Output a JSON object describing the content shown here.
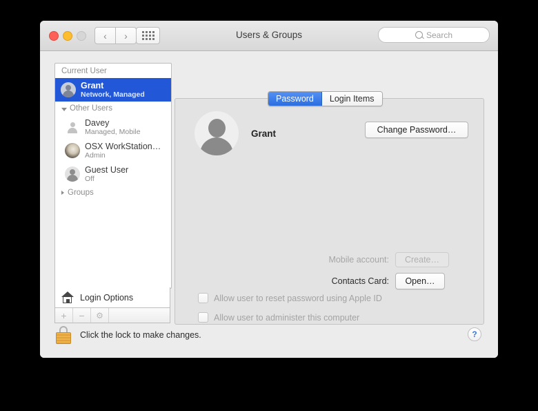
{
  "window": {
    "title": "Users & Groups",
    "traffic_lights": [
      "close-button",
      "minimize-button",
      "zoom-button"
    ],
    "nav": {
      "back": "‹",
      "forward": "›"
    },
    "grid_button": "show-all-preferences"
  },
  "search": {
    "placeholder": "Search"
  },
  "sidebar": {
    "current_user_header": "Current User",
    "current_user": {
      "name": "Grant",
      "status": "Network, Managed"
    },
    "other_users_header": "Other Users",
    "other_users": [
      {
        "name": "Davey",
        "status": "Managed, Mobile",
        "avatar": "plain-silhouette"
      },
      {
        "name": "OSX WorkStation…",
        "status": "Admin",
        "avatar": "photo"
      },
      {
        "name": "Guest User",
        "status": "Off",
        "avatar": "circle-silhouette"
      }
    ],
    "groups_header": "Groups",
    "login_options": "Login Options",
    "toolbar": {
      "add": "+",
      "remove": "−",
      "settings": "⚙"
    }
  },
  "tabs": [
    {
      "label": "Password",
      "active": true
    },
    {
      "label": "Login Items",
      "active": false
    }
  ],
  "main": {
    "user_name": "Grant",
    "change_password_button": "Change Password…",
    "mobile_account_label": "Mobile account:",
    "mobile_account_button": "Create…",
    "contacts_card_label": "Contacts Card:",
    "contacts_card_button": "Open…",
    "checkbox_reset_password": "Allow user to reset password using Apple ID",
    "checkbox_administer": "Allow user to administer this computer"
  },
  "footer": {
    "lock_text": "Click the lock to make changes.",
    "help_label": "?"
  },
  "colors": {
    "selection_blue": "#2258d8",
    "tab_active_blue": "#2b6ee0",
    "help_blue": "#3b78d8",
    "lock_gold": "#e0a23c",
    "window_background": "#ececec",
    "panel_background": "#e3e3e3"
  }
}
